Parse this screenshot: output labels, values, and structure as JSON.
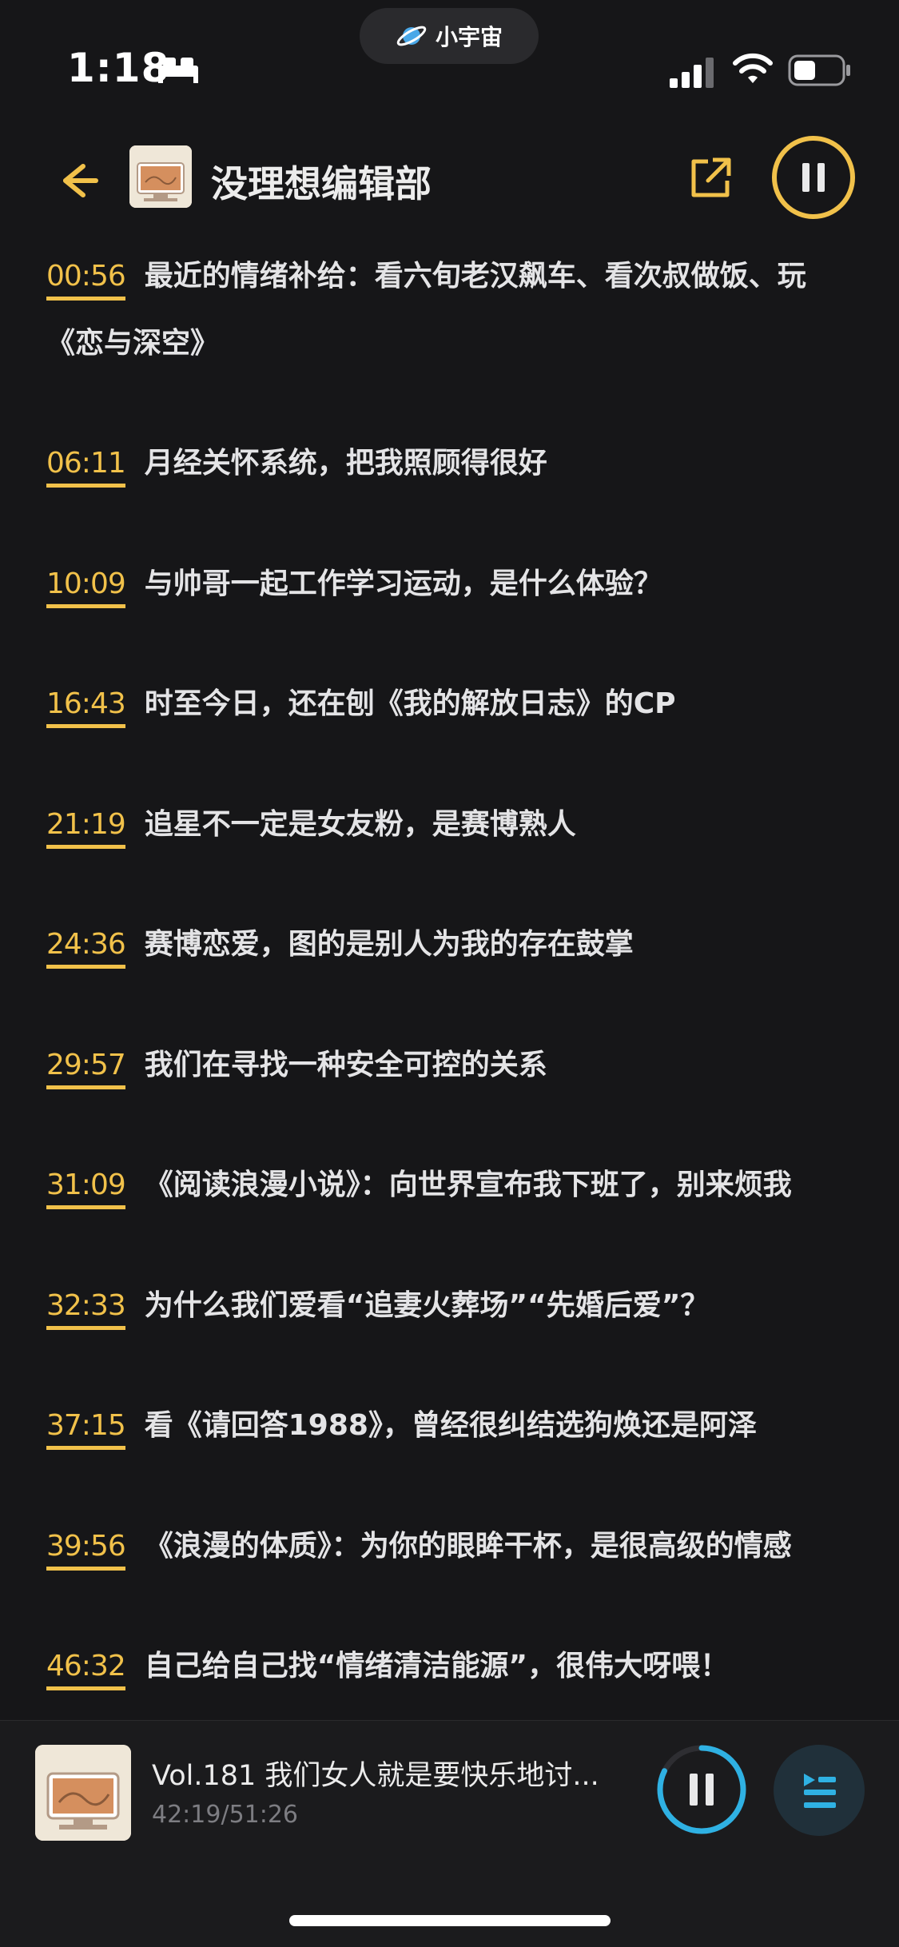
{
  "status_bar": {
    "time": "1:18",
    "app_pill_label": "小宇宙",
    "icons": [
      "bed-icon",
      "signal-icon",
      "wifi-icon",
      "battery-icon"
    ]
  },
  "header": {
    "podcast_title": "没理想编辑部",
    "logo_text": "没理想编辑部",
    "icons": [
      "back-arrow-icon",
      "share-icon",
      "pause-icon"
    ]
  },
  "chapters": [
    {
      "ts": "00:56",
      "title": "最近的情绪补给：看六旬老汉飙车、看次叔做饭、玩《恋与深空》"
    },
    {
      "ts": "06:11",
      "title": "月经关怀系统，把我照顾得很好"
    },
    {
      "ts": "10:09",
      "title": "与帅哥一起工作学习运动，是什么体验？"
    },
    {
      "ts": "16:43",
      "title": "时至今日，还在刨《我的解放日志》的CP"
    },
    {
      "ts": "21:19",
      "title": "追星不一定是女友粉，是赛博熟人"
    },
    {
      "ts": "24:36",
      "title": "赛博恋爱，图的是别人为我的存在鼓掌"
    },
    {
      "ts": "29:57",
      "title": "我们在寻找一种安全可控的关系"
    },
    {
      "ts": "31:09",
      "title": "《阅读浪漫小说》：向世界宣布我下班了，别来烦我"
    },
    {
      "ts": "32:33",
      "title": "为什么我们爱看“追妻火葬场”“先婚后爱”？"
    },
    {
      "ts": "37:15",
      "title": "看《请回答1988》，曾经很纠结选狗焕还是阿泽"
    },
    {
      "ts": "39:56",
      "title": "《浪漫的体质》：为你的眼眸干杯，是很高级的情感"
    },
    {
      "ts": "46:32",
      "title": "自己给自己找“情绪清洁能源”，很伟大呀喂！"
    }
  ],
  "mini_player": {
    "episode_title": "Vol.181 我们女人就是要快乐地讨...",
    "progress_text": "42:19/51:26",
    "progress_fraction": 0.823,
    "icons": [
      "pause-icon",
      "playlist-icon"
    ]
  },
  "colors": {
    "background": "#161618",
    "accent": "#f1c14a",
    "player_accent": "#2fb1e3"
  }
}
